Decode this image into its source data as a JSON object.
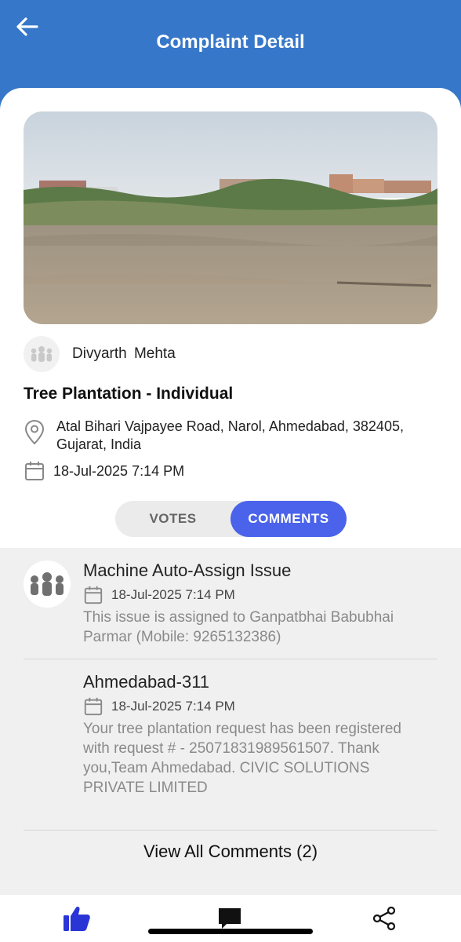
{
  "header": {
    "title": "Complaint Detail"
  },
  "complaint": {
    "author": "Divyarth  Mehta",
    "title": "Tree Plantation - Individual",
    "address": "Atal Bihari Vajpayee Road, Narol, Ahmedabad, 382405, Gujarat, India",
    "date": "18-Jul-2025 7:14 PM"
  },
  "tabs": {
    "votes": "VOTES",
    "comments": "COMMENTS",
    "active": "comments"
  },
  "comments": [
    {
      "title": "Machine Auto-Assign Issue",
      "date": "18-Jul-2025 7:14 PM",
      "body": "This issue is assigned to Ganpatbhai Babubhai Parmar (Mobile: 9265132386)"
    },
    {
      "title": "Ahmedabad-311",
      "date": "18-Jul-2025 7:14 PM",
      "body": "Your tree plantation request has been registered with request # - 25071831989561507. Thank you,Team Ahmedabad. CIVIC SOLUTIONS PRIVATE LIMITED"
    }
  ],
  "view_all": "View All Comments (2)",
  "bottom_bar": {
    "icons": [
      "thumbs-up-icon",
      "comment-icon",
      "share-icon"
    ]
  },
  "colors": {
    "header": "#3677c9",
    "accent": "#4a63ea",
    "thumb": "#2a35d6"
  }
}
